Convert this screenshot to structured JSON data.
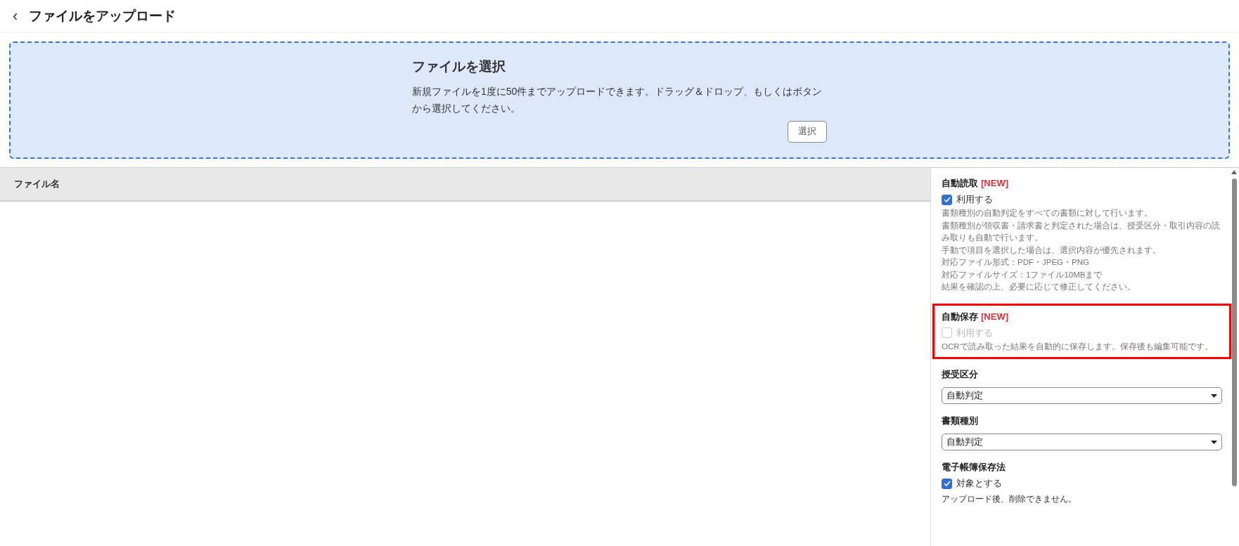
{
  "header": {
    "back": "‹",
    "title": "ファイルをアップロード"
  },
  "dropzone": {
    "title": "ファイルを選択",
    "description": "新規ファイルを1度に50件までアップロードできます。ドラッグ＆ドロップ、もしくはボタンから選択してください。",
    "button": "選択"
  },
  "table": {
    "columns": [
      "ファイル名"
    ]
  },
  "settings": [
    {
      "kind": "checkbox",
      "label": "自動読取",
      "badge": "[NEW]",
      "highlighted": false,
      "option": {
        "label": "利用する",
        "checked": true,
        "disabled": false
      },
      "description": [
        "書類種別の自動判定をすべての書類に対して行います。",
        "書類種別が領収書・請求書と判定された場合は、授受区分・取引内容の読み取りも自動で行います。",
        "手動で項目を選択した場合は、選択内容が優先されます。",
        "対応ファイル形式：PDF・JPEG・PNG",
        "対応ファイルサイズ：1ファイル10MBまで",
        "結果を確認の上、必要に応じて修正してください。"
      ]
    },
    {
      "kind": "checkbox",
      "label": "自動保存",
      "badge": "[NEW]",
      "highlighted": true,
      "option": {
        "label": "利用する",
        "checked": false,
        "disabled": true
      },
      "description": [
        "OCRで読み取った結果を自動的に保存します。保存後も編集可能です。"
      ]
    },
    {
      "kind": "select",
      "label": "授受区分",
      "value": "自動判定"
    },
    {
      "kind": "select",
      "label": "書類種別",
      "value": "自動判定"
    },
    {
      "kind": "checkbox",
      "label": "電子帳簿保存法",
      "highlighted": false,
      "option": {
        "label": "対象とする",
        "checked": true,
        "disabled": false
      },
      "description": [
        "アップロード後、削除できません。"
      ],
      "description_dark": true
    }
  ]
}
